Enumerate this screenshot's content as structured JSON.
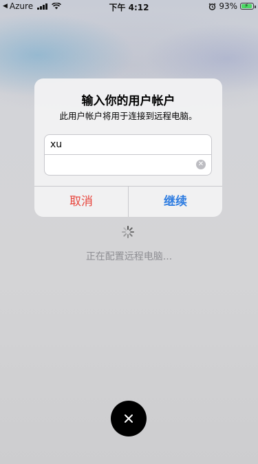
{
  "status_bar": {
    "carrier": "Azure",
    "time": "下午 4:12",
    "battery_percent": "93%",
    "battery_level": 0.93,
    "icons": [
      "back-arrow-icon",
      "signal-icon",
      "wifi-icon",
      "alarm-icon",
      "battery-charging-icon"
    ]
  },
  "dialog": {
    "title": "输入你的用户帐户",
    "message": "此用户帐户将用于连接到远程电脑。",
    "username": {
      "value": "xu",
      "placeholder": ""
    },
    "password": {
      "value": "",
      "placeholder": ""
    },
    "cancel_label": "取消",
    "continue_label": "继续"
  },
  "status": {
    "text": "正在配置远程电脑..."
  },
  "colors": {
    "cancel": "#e8453c",
    "continue": "#2f7de1",
    "battery_fill": "#4cd964",
    "status_text": "#8e8e93"
  }
}
